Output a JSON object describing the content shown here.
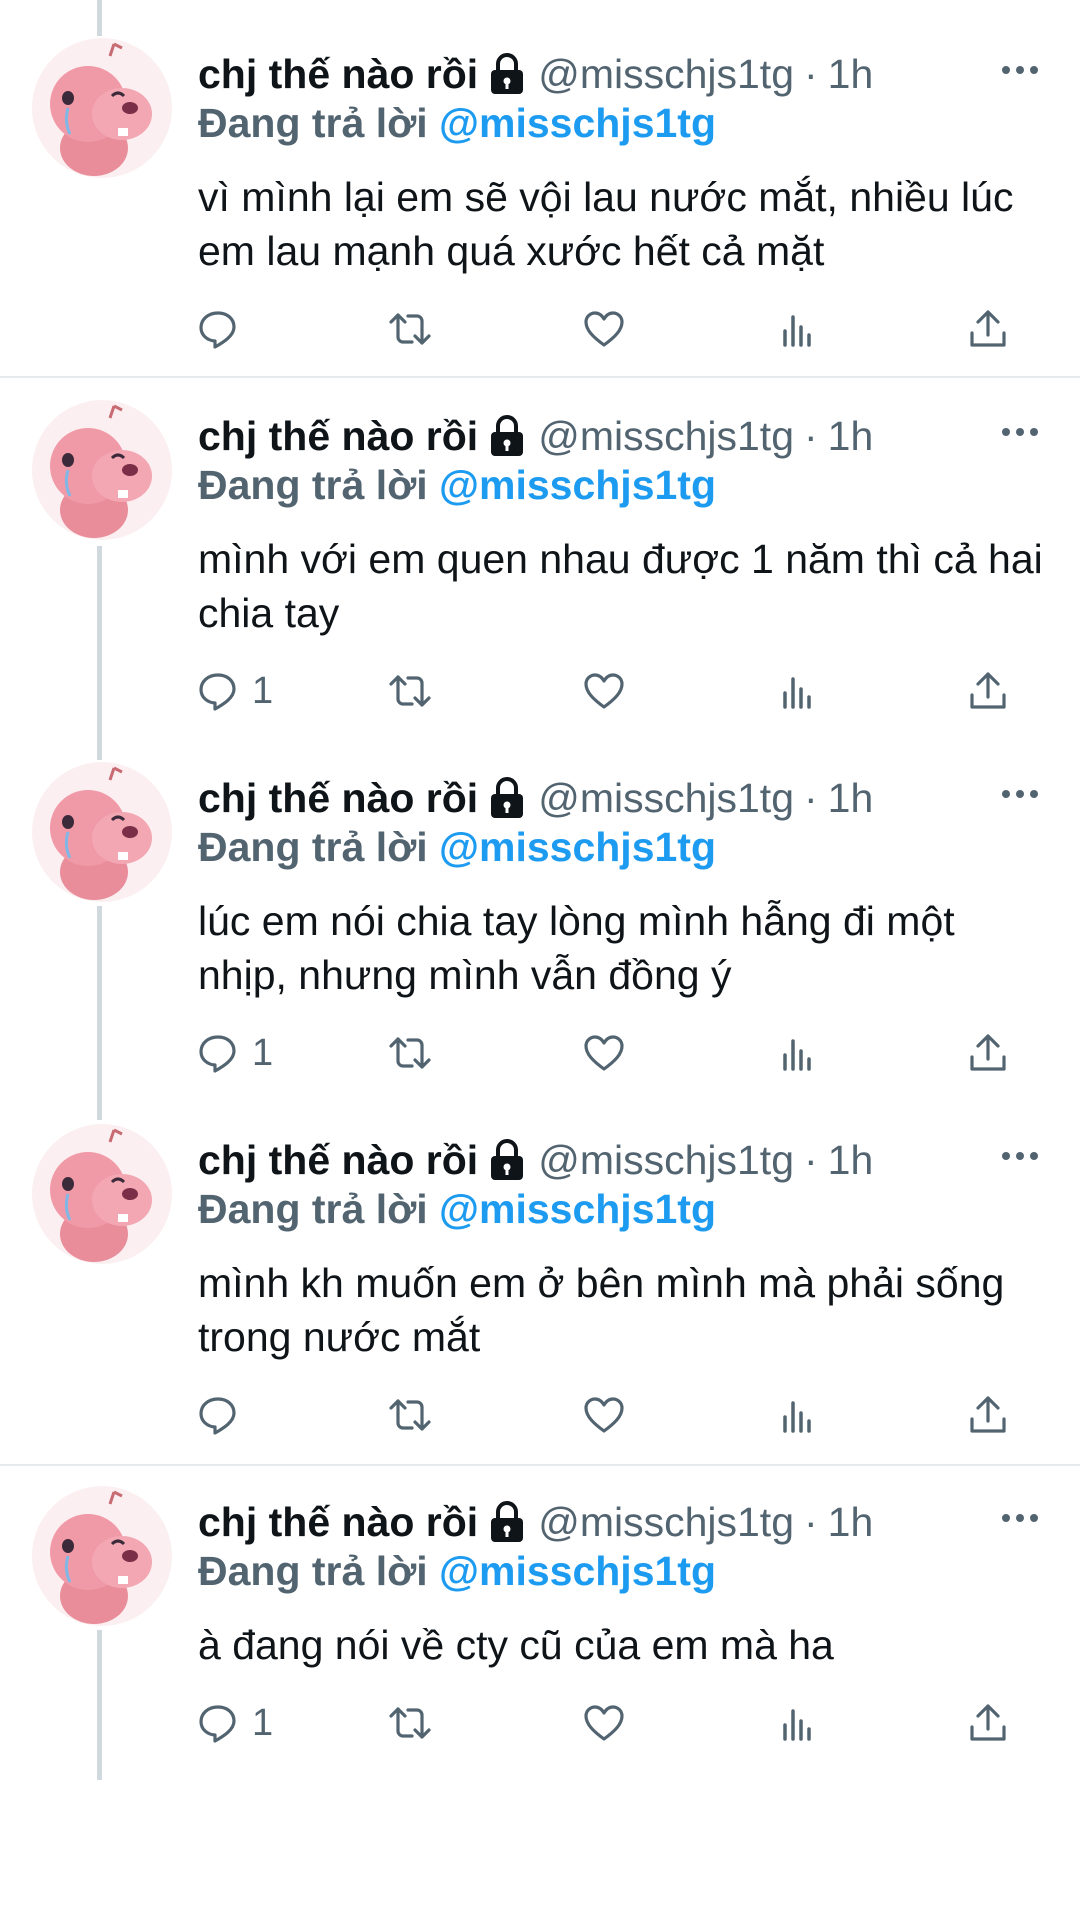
{
  "colors": {
    "text_primary": "#0f1419",
    "text_secondary": "#536471",
    "link_blue": "#1d9bf0",
    "thread_line": "#cfd9de",
    "divider": "#e6eaed"
  },
  "tweets": [
    {
      "display_name": "chj thế nào rồi",
      "handle": "@misschjs1tg",
      "separator": "·",
      "time": "1h",
      "reply_prefix": "Đang trả lời",
      "reply_handle": "@misschjs1tg",
      "text": "vì mình lại em sẽ vội lau nước mắt, nhiều lúc em lau mạnh quá xước hết cả mặt",
      "reply_count": ""
    },
    {
      "display_name": "chj thế nào rồi",
      "handle": "@misschjs1tg",
      "separator": "·",
      "time": "1h",
      "reply_prefix": "Đang trả lời",
      "reply_handle": "@misschjs1tg",
      "text": "mình với em quen nhau được 1 năm thì cả hai chia tay",
      "reply_count": "1"
    },
    {
      "display_name": "chj thế nào rồi",
      "handle": "@misschjs1tg",
      "separator": "·",
      "time": "1h",
      "reply_prefix": "Đang trả lời",
      "reply_handle": "@misschjs1tg",
      "text": "lúc em nói chia tay lòng mình hẫng đi một nhịp, nhưng mình vẫn đồng ý",
      "reply_count": "1"
    },
    {
      "display_name": "chj thế nào rồi",
      "handle": "@misschjs1tg",
      "separator": "·",
      "time": "1h",
      "reply_prefix": "Đang trả lời",
      "reply_handle": "@misschjs1tg",
      "text": "mình kh muốn em ở bên mình mà phải sống trong nước mắt",
      "reply_count": ""
    },
    {
      "display_name": "chj thế nào rồi",
      "handle": "@misschjs1tg",
      "separator": "·",
      "time": "1h",
      "reply_prefix": "Đang trả lời",
      "reply_handle": "@misschjs1tg",
      "text": "à đang nói về cty cũ của em mà ha",
      "reply_count": "1"
    }
  ],
  "icons": {
    "lock": "lock-icon",
    "more": "more-icon",
    "reply": "reply-icon",
    "retweet": "retweet-icon",
    "like": "heart-icon",
    "views": "analytics-icon",
    "share": "share-icon"
  }
}
